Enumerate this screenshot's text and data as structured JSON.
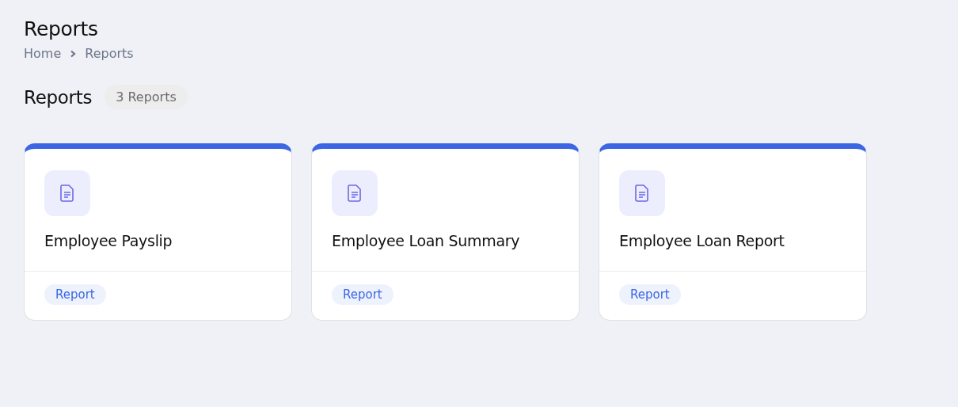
{
  "page_title": "Reports",
  "breadcrumb": [
    "Home",
    "Reports"
  ],
  "section": {
    "title": "Reports",
    "count": "3 Reports"
  },
  "cards": [
    {
      "title": "Employee Payslip",
      "tag": "Report"
    },
    {
      "title": "Employee Loan Summary",
      "tag": "Report"
    },
    {
      "title": "Employee Loan Report",
      "tag": "Report"
    }
  ]
}
